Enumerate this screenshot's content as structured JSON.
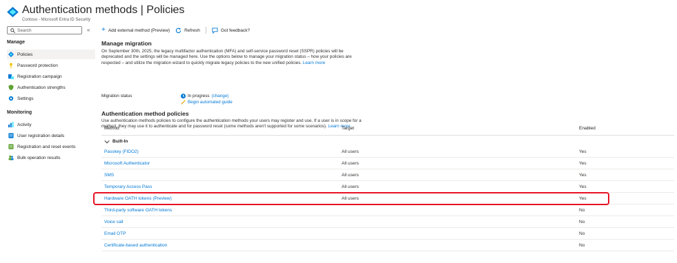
{
  "header": {
    "title": "Authentication methods | Policies",
    "subtitle": "Contoso - Microsoft Entra ID Security",
    "more": "···"
  },
  "sidebar": {
    "search_placeholder": "Search",
    "collapse": "«",
    "manage_heading": "Manage",
    "manage_items": [
      {
        "label": "Policies",
        "icon": "azure-diamond-icon"
      },
      {
        "label": "Password protection",
        "icon": "key-icon"
      },
      {
        "label": "Registration campaign",
        "icon": "campaign-icon"
      },
      {
        "label": "Authentication strengths",
        "icon": "shield-icon"
      },
      {
        "label": "Settings",
        "icon": "gear-icon"
      }
    ],
    "monitoring_heading": "Monitoring",
    "monitoring_items": [
      {
        "label": "Activity",
        "icon": "bar-chart-icon"
      },
      {
        "label": "User registration details",
        "icon": "registration-icon"
      },
      {
        "label": "Registration and reset events",
        "icon": "events-icon"
      },
      {
        "label": "Bulk operation results",
        "icon": "users-icon"
      }
    ]
  },
  "toolbar": {
    "add": "Add external method (Preview)",
    "refresh": "Refresh",
    "feedback": "Got feedback?"
  },
  "migration": {
    "heading": "Manage migration",
    "text": "On September 30th, 2025, the legacy multifactor authentication (MFA) and self-service password reset (SSPR) policies will be deprecated and the settings will be managed here. Use the options below to manage your migration status – how your policies are respected – and utilize the migration wizard to quickly migrate legacy policies to the new unified policies.",
    "learn_more": "Learn more",
    "status_label": "Migration status",
    "status_value": "In progress",
    "change": "(change)",
    "guide": "Begin automated guide"
  },
  "policies": {
    "heading": "Authentication method policies",
    "text": "Use authentication methods policies to configure the authentication methods your users may register and use. If a user is in scope for a method, they may use it to authenticate and for password reset (some methods aren't supported for some scenarios).",
    "learn_more": "Learn more"
  },
  "table": {
    "columns": [
      "Method",
      "Target",
      "Enabled"
    ],
    "group": "Built-In",
    "rows": [
      {
        "method": "Passkey (FIDO2)",
        "target": "All users",
        "enabled": "Yes"
      },
      {
        "method": "Microsoft Authenticator",
        "target": "All users",
        "enabled": "Yes"
      },
      {
        "method": "SMS",
        "target": "All users",
        "enabled": "Yes"
      },
      {
        "method": "Temporary Access Pass",
        "target": "All users",
        "enabled": "Yes"
      },
      {
        "method": "Hardware OATH tokens (Preview)",
        "target": "All users",
        "enabled": "Yes"
      },
      {
        "method": "Third-party software OATH tokens",
        "target": "",
        "enabled": "No"
      },
      {
        "method": "Voice call",
        "target": "",
        "enabled": "No"
      },
      {
        "method": "Email OTP",
        "target": "",
        "enabled": "No"
      },
      {
        "method": "Certificate-based authentication",
        "target": "",
        "enabled": "No"
      }
    ]
  },
  "colors": {
    "accent": "#0078d4",
    "highlight": "#e81123",
    "active_bg": "#f3f2f1"
  }
}
